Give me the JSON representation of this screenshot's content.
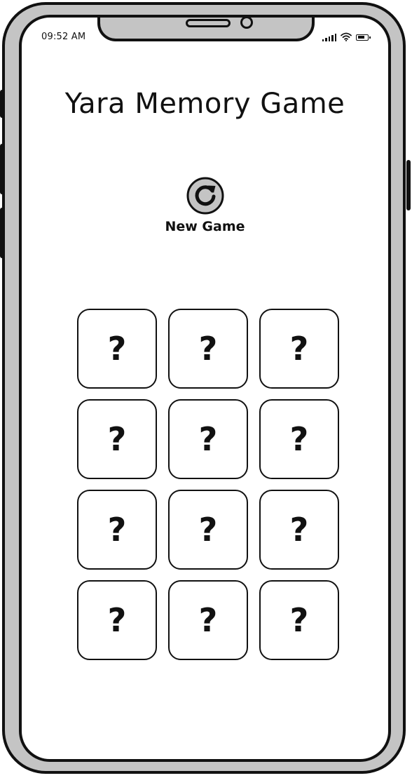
{
  "status_bar": {
    "time": "09:52 AM",
    "icons": [
      "signal-icon",
      "wifi-icon",
      "battery-icon"
    ]
  },
  "app": {
    "title": "Yara Memory Game",
    "new_game_label": "New Game",
    "new_game_icon": "refresh-icon"
  },
  "cards": [
    {
      "face": "?"
    },
    {
      "face": "?"
    },
    {
      "face": "?"
    },
    {
      "face": "?"
    },
    {
      "face": "?"
    },
    {
      "face": "?"
    },
    {
      "face": "?"
    },
    {
      "face": "?"
    },
    {
      "face": "?"
    },
    {
      "face": "?"
    },
    {
      "face": "?"
    },
    {
      "face": "?"
    }
  ],
  "colors": {
    "frame": "#c4c4c4",
    "ink": "#111111",
    "screen": "#ffffff"
  }
}
